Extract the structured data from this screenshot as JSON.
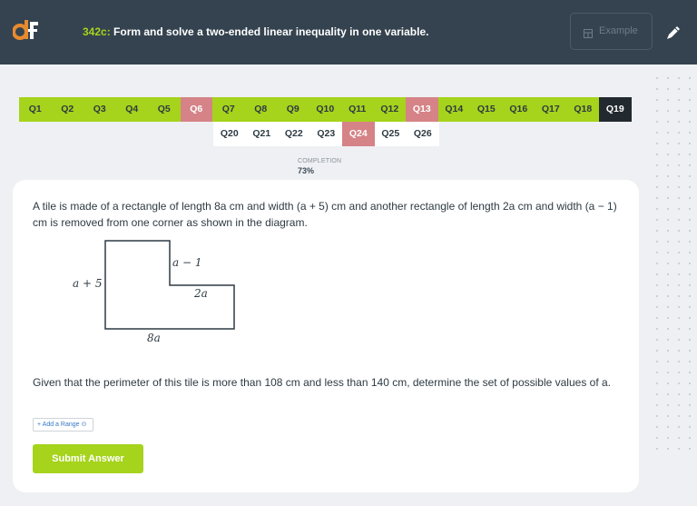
{
  "header": {
    "logo_text": "df",
    "task_code": "342c:",
    "task_title": "Form and solve a two-ended linear inequality in one variable.",
    "example_label": "Example",
    "example_icon": "calculator-icon",
    "pen_icon": "pen-icon"
  },
  "question_tabs": [
    {
      "label": "Q1",
      "status": "correct"
    },
    {
      "label": "Q2",
      "status": "correct"
    },
    {
      "label": "Q3",
      "status": "correct"
    },
    {
      "label": "Q4",
      "status": "correct"
    },
    {
      "label": "Q5",
      "status": "correct"
    },
    {
      "label": "Q6",
      "status": "wrong"
    },
    {
      "label": "Q7",
      "status": "correct"
    },
    {
      "label": "Q8",
      "status": "correct"
    },
    {
      "label": "Q9",
      "status": "correct"
    },
    {
      "label": "Q10",
      "status": "correct"
    },
    {
      "label": "Q11",
      "status": "correct"
    },
    {
      "label": "Q12",
      "status": "correct"
    },
    {
      "label": "Q13",
      "status": "wrong"
    },
    {
      "label": "Q14",
      "status": "correct"
    },
    {
      "label": "Q15",
      "status": "correct"
    },
    {
      "label": "Q16",
      "status": "correct"
    },
    {
      "label": "Q17",
      "status": "correct"
    },
    {
      "label": "Q18",
      "status": "correct"
    },
    {
      "label": "Q19",
      "status": "current"
    },
    {
      "label": "Q20",
      "status": "unanswered"
    },
    {
      "label": "Q21",
      "status": "unanswered"
    },
    {
      "label": "Q22",
      "status": "unanswered"
    },
    {
      "label": "Q23",
      "status": "unanswered"
    },
    {
      "label": "Q24",
      "status": "wrong"
    },
    {
      "label": "Q25",
      "status": "unanswered"
    },
    {
      "label": "Q26",
      "status": "unanswered"
    }
  ],
  "completion": {
    "label": "COMPLETION",
    "value": "73%"
  },
  "question": {
    "text1": "A tile is made of a rectangle of length 8a cm and width (a + 5) cm and another rectangle of length 2a cm and width (a − 1) cm is removed from one corner as shown in the diagram.",
    "diagram_labels": {
      "left": "a + 5",
      "notch_vertical": "a − 1",
      "notch_horizontal": "2a",
      "bottom": "8a"
    },
    "text2": "Given that the perimeter of this tile is more than 108 cm and less than 140 cm, determine the set of possible values of a."
  },
  "actions": {
    "add_range": "+ Add a Range ⊙",
    "submit": "Submit Answer"
  },
  "colors": {
    "header_bg": "#34434f",
    "accent": "#a6d31c",
    "wrong": "#d58387",
    "current": "#222a30",
    "link": "#3478c6"
  }
}
